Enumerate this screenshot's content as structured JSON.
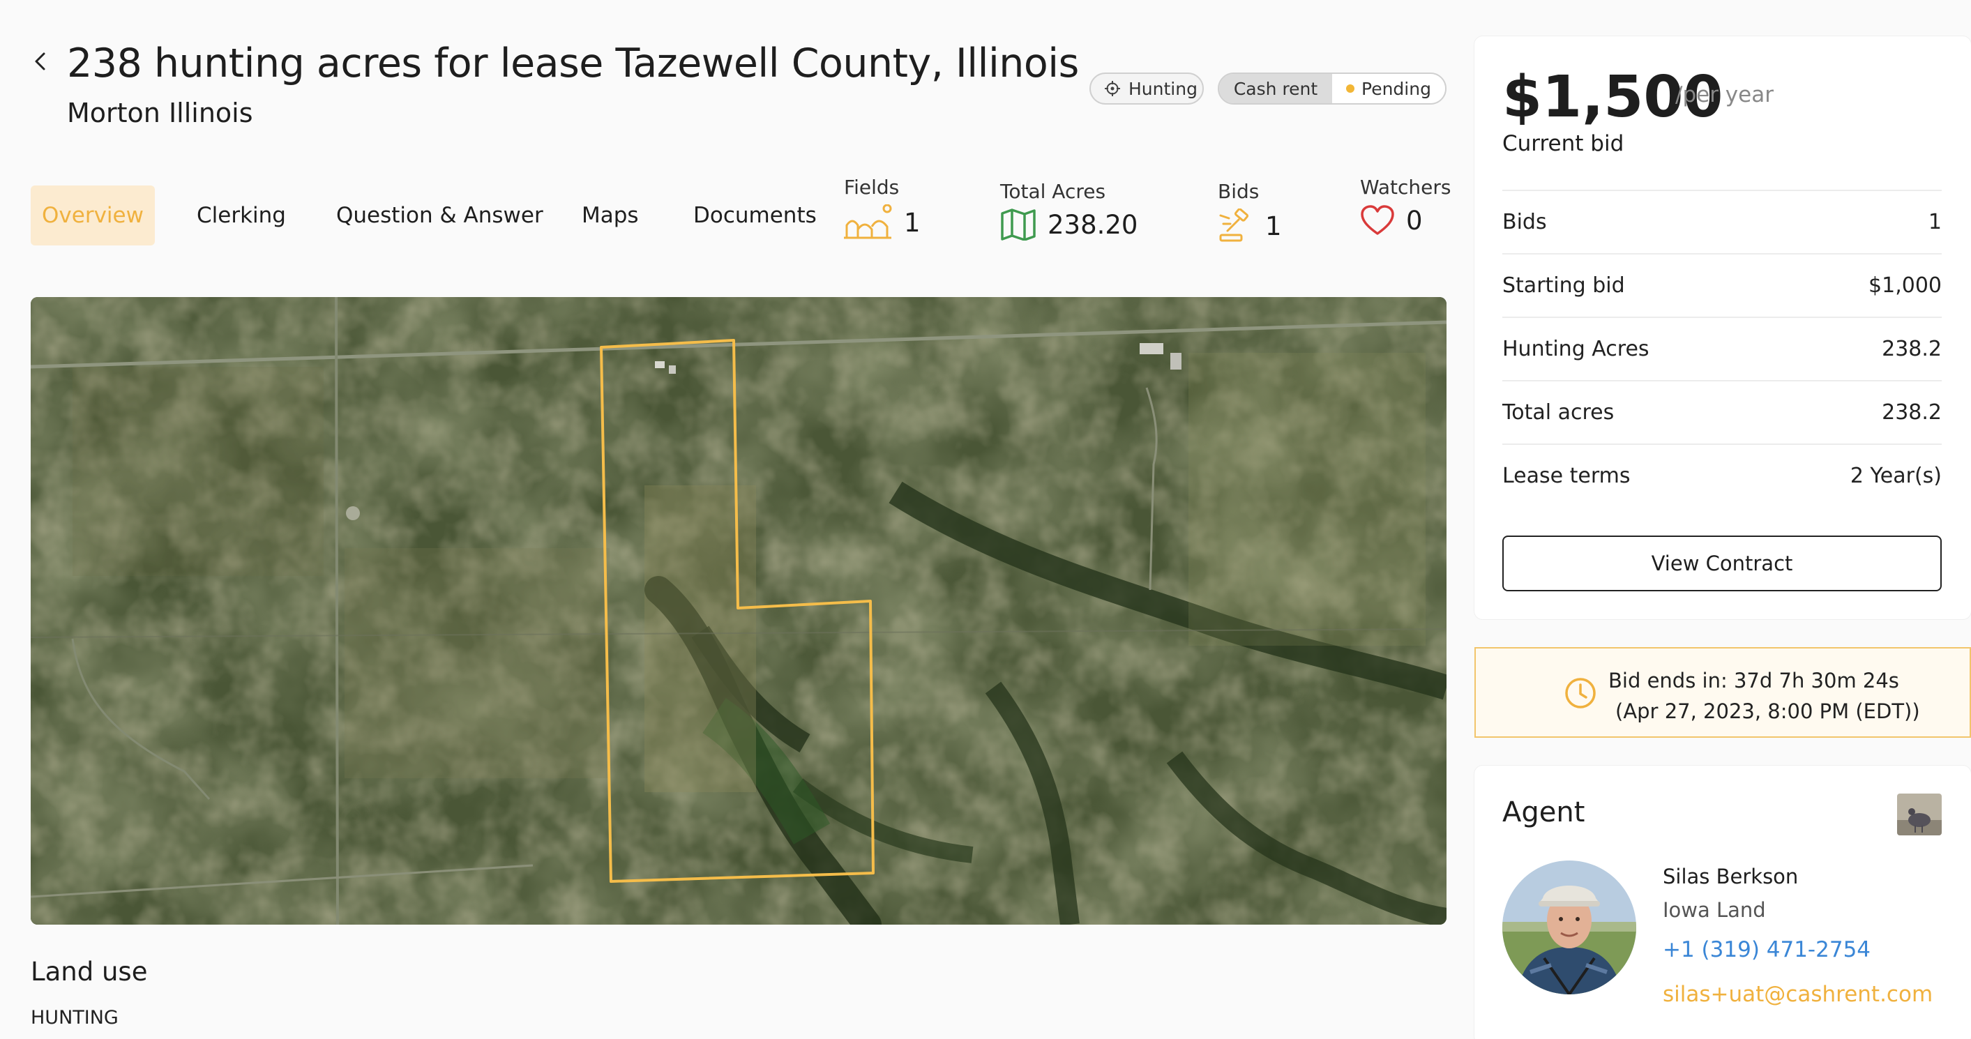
{
  "header": {
    "title": "238 hunting acres for lease Tazewell County, Illinois",
    "subtitle": "Morton Illinois",
    "back_icon": "chevron-left-icon"
  },
  "chips": {
    "hunting": "Hunting",
    "cash_rent": "Cash rent",
    "pending": "Pending",
    "pending_color": "#f2b636"
  },
  "tabs": [
    {
      "label": "Overview",
      "active": true
    },
    {
      "label": "Clerking",
      "active": false
    },
    {
      "label": "Question & Answer",
      "active": false
    },
    {
      "label": "Maps",
      "active": false
    },
    {
      "label": "Documents",
      "active": false
    }
  ],
  "stats": {
    "fields": {
      "label": "Fields",
      "value": "1",
      "icon": "fields-icon"
    },
    "total_acres": {
      "label": "Total Acres",
      "value": "238.20",
      "icon": "map-icon"
    },
    "bids": {
      "label": "Bids",
      "value": "1",
      "icon": "gavel-icon"
    },
    "watchers": {
      "label": "Watchers",
      "value": "0",
      "icon": "heart-icon"
    }
  },
  "land_use": {
    "title": "Land use",
    "value": "HUNTING"
  },
  "bid_card": {
    "price": "$1,500",
    "period": "/per year",
    "current_bid_label": "Current bid",
    "rows": [
      {
        "label": "Bids",
        "value": "1"
      },
      {
        "label": "Starting bid",
        "value": "$1,000"
      },
      {
        "label": "Hunting Acres",
        "value": "238.2"
      },
      {
        "label": "Total acres",
        "value": "238.2"
      },
      {
        "label": "Lease terms",
        "value": "2 Year(s)"
      }
    ],
    "view_contract_label": "View Contract"
  },
  "timer": {
    "line1": "Bid ends in: 37d 7h 30m 24s",
    "line2": "(Apr 27, 2023, 8:00 PM (EDT))",
    "icon": "clock-icon"
  },
  "agent": {
    "title": "Agent",
    "name": "Silas Berkson",
    "company": "Iowa Land",
    "phone": "+1 (319) 471-2754",
    "email": "silas+uat@cashrent.com"
  },
  "colors": {
    "accent": "#f0b13e",
    "accent_bg": "#fcebd0",
    "link": "#3a86d6",
    "boundary": "#f5bd4a",
    "map_icon_green": "#3f9a4f",
    "heart_red": "#d93a3a"
  }
}
